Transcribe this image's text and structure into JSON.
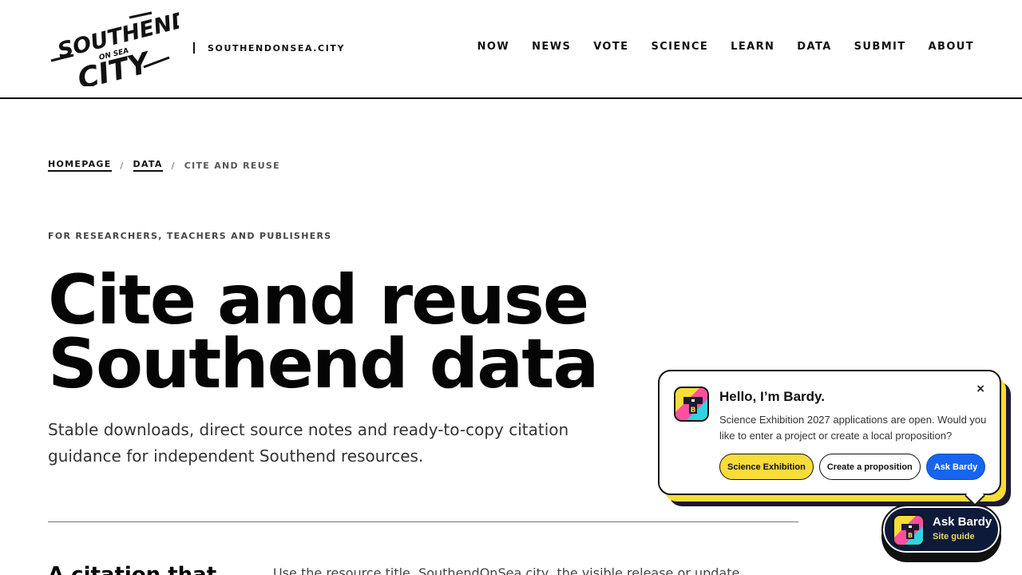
{
  "header": {
    "logo_alt": "Southend On Sea City",
    "logo_lines": [
      "SOUTHEND",
      "ON SEA",
      "CITY"
    ],
    "domain": "SOUTHENDONSEA.CITY",
    "nav": [
      "NOW",
      "NEWS",
      "VOTE",
      "SCIENCE",
      "LEARN",
      "DATA",
      "SUBMIT",
      "ABOUT"
    ]
  },
  "breadcrumb": {
    "home": "HOMEPAGE",
    "separator": "/",
    "data": "DATA",
    "current": "CITE AND REUSE"
  },
  "hero": {
    "eyebrow": "FOR RESEARCHERS, TEACHERS AND PUBLISHERS",
    "title_line1": "Cite and reuse",
    "title_line2": "Southend data",
    "subtitle": "Stable downloads, direct source notes and ready-to-copy citation guidance for independent Southend resources."
  },
  "section": {
    "heading": "A citation that",
    "body": "Use the resource title, SouthendOnSea.city, the visible release or update"
  },
  "bardy": {
    "title": "Hello, I’m Bardy.",
    "message": "Science Exhibition 2027 applications are open. Would you like to enter a project or create a local proposition?",
    "close": "×",
    "actions": {
      "science": "Science Exhibition",
      "proposition": "Create a proposition",
      "ask": "Ask Bardy"
    },
    "launcher": {
      "label": "Ask Bardy",
      "sub": "Site guide"
    }
  },
  "colors": {
    "accent_yellow": "#f7dc3a",
    "accent_blue": "#1664f0",
    "launcher_bg": "#0e1a3a",
    "ink": "#111111"
  }
}
